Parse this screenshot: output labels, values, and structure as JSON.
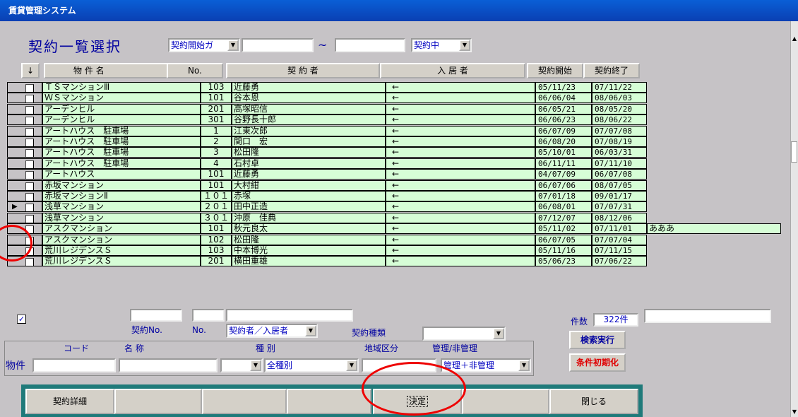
{
  "window": {
    "title": "賃貸管理システム"
  },
  "heading": "契約一覧選択",
  "filters": {
    "date_field": "契約開始ガ",
    "range_sep": "~",
    "status": "契約中"
  },
  "columns": {
    "sort": "↓",
    "property": "物 件 名",
    "no": "No.",
    "contractor": "契 約 者",
    "resident": "入 居 者",
    "start": "契約開始",
    "end": "契約終了"
  },
  "rows": [
    {
      "property": "ＴＳマンションⅢ",
      "no": "103",
      "contractor": "近藤勇",
      "resident": "←",
      "start": "05/11/23",
      "end": "07/11/22",
      "note": ""
    },
    {
      "property": "ＷＳマンション",
      "no": "101",
      "contractor": "谷本恩",
      "resident": "←",
      "start": "06/06/04",
      "end": "08/06/03",
      "note": ""
    },
    {
      "property": "アーデンヒル",
      "no": "201",
      "contractor": "高塚昭信",
      "resident": "←",
      "start": "06/05/21",
      "end": "08/05/20",
      "note": ""
    },
    {
      "property": "アーデンヒル",
      "no": "301",
      "contractor": "谷野長十郎",
      "resident": "←",
      "start": "06/06/23",
      "end": "08/06/22",
      "note": ""
    },
    {
      "property": "アートハウス　駐車場",
      "no": "1",
      "contractor": "江東次郎",
      "resident": "←",
      "start": "06/07/09",
      "end": "07/07/08",
      "note": ""
    },
    {
      "property": "アートハウス　駐車場",
      "no": "2",
      "contractor": "関口　宏",
      "resident": "←",
      "start": "06/08/20",
      "end": "07/08/19",
      "note": ""
    },
    {
      "property": "アートハウス　駐車場",
      "no": "3",
      "contractor": "松田隆",
      "resident": "←",
      "start": "05/10/01",
      "end": "06/03/31",
      "note": ""
    },
    {
      "property": "アートハウス　駐車場",
      "no": "4",
      "contractor": "石村卓",
      "resident": "←",
      "start": "06/11/11",
      "end": "07/11/10",
      "note": ""
    },
    {
      "property": "アートハウス",
      "no": "101",
      "contractor": "近藤勇",
      "resident": "←",
      "start": "04/07/09",
      "end": "06/07/08",
      "note": ""
    },
    {
      "property": "赤坂マンション",
      "no": "101",
      "contractor": "大村紺",
      "resident": "←",
      "start": "06/07/06",
      "end": "08/07/05",
      "note": ""
    },
    {
      "property": "赤坂マンションⅡ",
      "no": "１０１",
      "contractor": "赤塚",
      "resident": "←",
      "start": "07/01/18",
      "end": "09/01/17",
      "note": ""
    },
    {
      "property": "浅草マンション",
      "no": "２０１",
      "contractor": "田中正造",
      "resident": "←",
      "start": "06/08/01",
      "end": "07/07/31",
      "note": ""
    },
    {
      "property": "浅草マンション",
      "no": "３０１",
      "contractor": "沖原　佳典",
      "resident": "←",
      "start": "07/12/07",
      "end": "08/12/06",
      "note": ""
    },
    {
      "property": "アスクマンション",
      "no": "101",
      "contractor": "秋元良太",
      "resident": "←",
      "start": "05/11/02",
      "end": "07/11/01",
      "note": "あああ"
    },
    {
      "property": "アスクマンション",
      "no": "102",
      "contractor": "松田隆",
      "resident": "←",
      "start": "06/07/05",
      "end": "07/07/04",
      "note": ""
    },
    {
      "property": "荒川レジデンスＳ",
      "no": "103",
      "contractor": "中本博光",
      "resident": "←",
      "start": "05/11/16",
      "end": "07/11/15",
      "note": ""
    },
    {
      "property": "荒川レジデンスＳ",
      "no": "201",
      "contractor": "横田重雄",
      "resident": "←",
      "start": "05/06/23",
      "end": "07/06/22",
      "note": ""
    }
  ],
  "search": {
    "contract_no_label": "契約No.",
    "no_label": "No.",
    "party_select": "契約者／入居者",
    "contract_type_label": "契約種類",
    "count_label": "件数",
    "count_value": "322件",
    "group": {
      "code_label": "コード",
      "name_label": "名 称",
      "kind_label": "種 別",
      "area_label": "地域区分",
      "mgmt_label": "管理/非管理",
      "property_label": "物件",
      "kind_value": "全種別",
      "mgmt_value": "管理＋非管理"
    },
    "search_button": "検索実行",
    "reset_button": "条件初期化"
  },
  "footer": {
    "detail_button": "契約詳細",
    "decide_button": "決定",
    "close_button": "閉じる"
  },
  "colors": {
    "row_bg": "#d6fdd6",
    "heading": "#0000a0",
    "title_bar": "#0a4fc6",
    "annotation": "#e00000",
    "reset_text": "#e00000"
  },
  "icons": {
    "checkbox_checked": "✓",
    "combo_arrow": "▼",
    "row_pointer": "▶"
  }
}
